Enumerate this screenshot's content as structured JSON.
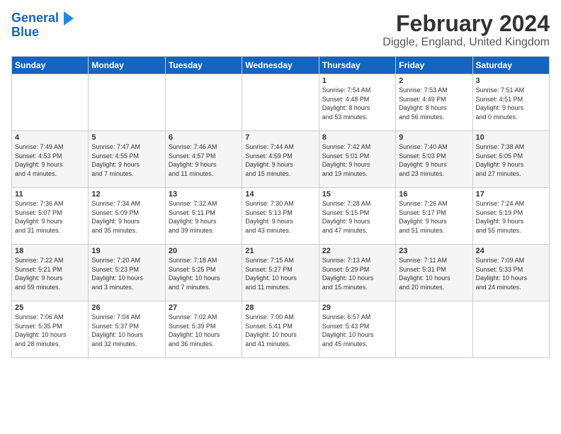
{
  "logo": {
    "line1": "General",
    "line2": "Blue"
  },
  "title": "February 2024",
  "subtitle": "Diggle, England, United Kingdom",
  "days_header": [
    "Sunday",
    "Monday",
    "Tuesday",
    "Wednesday",
    "Thursday",
    "Friday",
    "Saturday"
  ],
  "weeks": [
    [
      {
        "day": "",
        "content": ""
      },
      {
        "day": "",
        "content": ""
      },
      {
        "day": "",
        "content": ""
      },
      {
        "day": "",
        "content": ""
      },
      {
        "day": "1",
        "content": "Sunrise: 7:54 AM\nSunset: 4:48 PM\nDaylight: 8 hours\nand 53 minutes."
      },
      {
        "day": "2",
        "content": "Sunrise: 7:53 AM\nSunset: 4:49 PM\nDaylight: 8 hours\nand 56 minutes."
      },
      {
        "day": "3",
        "content": "Sunrise: 7:51 AM\nSunset: 4:51 PM\nDaylight: 9 hours\nand 0 minutes."
      }
    ],
    [
      {
        "day": "4",
        "content": "Sunrise: 7:49 AM\nSunset: 4:53 PM\nDaylight: 9 hours\nand 4 minutes."
      },
      {
        "day": "5",
        "content": "Sunrise: 7:47 AM\nSunset: 4:55 PM\nDaylight: 9 hours\nand 7 minutes."
      },
      {
        "day": "6",
        "content": "Sunrise: 7:46 AM\nSunset: 4:57 PM\nDaylight: 9 hours\nand 11 minutes."
      },
      {
        "day": "7",
        "content": "Sunrise: 7:44 AM\nSunset: 4:59 PM\nDaylight: 9 hours\nand 15 minutes."
      },
      {
        "day": "8",
        "content": "Sunrise: 7:42 AM\nSunset: 5:01 PM\nDaylight: 9 hours\nand 19 minutes."
      },
      {
        "day": "9",
        "content": "Sunrise: 7:40 AM\nSunset: 5:03 PM\nDaylight: 9 hours\nand 23 minutes."
      },
      {
        "day": "10",
        "content": "Sunrise: 7:38 AM\nSunset: 5:05 PM\nDaylight: 9 hours\nand 27 minutes."
      }
    ],
    [
      {
        "day": "11",
        "content": "Sunrise: 7:36 AM\nSunset: 5:07 PM\nDaylight: 9 hours\nand 31 minutes."
      },
      {
        "day": "12",
        "content": "Sunrise: 7:34 AM\nSunset: 5:09 PM\nDaylight: 9 hours\nand 35 minutes."
      },
      {
        "day": "13",
        "content": "Sunrise: 7:32 AM\nSunset: 5:11 PM\nDaylight: 9 hours\nand 39 minutes."
      },
      {
        "day": "14",
        "content": "Sunrise: 7:30 AM\nSunset: 5:13 PM\nDaylight: 9 hours\nand 43 minutes."
      },
      {
        "day": "15",
        "content": "Sunrise: 7:28 AM\nSunset: 5:15 PM\nDaylight: 9 hours\nand 47 minutes."
      },
      {
        "day": "16",
        "content": "Sunrise: 7:26 AM\nSunset: 5:17 PM\nDaylight: 9 hours\nand 51 minutes."
      },
      {
        "day": "17",
        "content": "Sunrise: 7:24 AM\nSunset: 5:19 PM\nDaylight: 9 hours\nand 55 minutes."
      }
    ],
    [
      {
        "day": "18",
        "content": "Sunrise: 7:22 AM\nSunset: 5:21 PM\nDaylight: 9 hours\nand 59 minutes."
      },
      {
        "day": "19",
        "content": "Sunrise: 7:20 AM\nSunset: 5:23 PM\nDaylight: 10 hours\nand 3 minutes."
      },
      {
        "day": "20",
        "content": "Sunrise: 7:18 AM\nSunset: 5:25 PM\nDaylight: 10 hours\nand 7 minutes."
      },
      {
        "day": "21",
        "content": "Sunrise: 7:15 AM\nSunset: 5:27 PM\nDaylight: 10 hours\nand 11 minutes."
      },
      {
        "day": "22",
        "content": "Sunrise: 7:13 AM\nSunset: 5:29 PM\nDaylight: 10 hours\nand 15 minutes."
      },
      {
        "day": "23",
        "content": "Sunrise: 7:11 AM\nSunset: 5:31 PM\nDaylight: 10 hours\nand 20 minutes."
      },
      {
        "day": "24",
        "content": "Sunrise: 7:09 AM\nSunset: 5:33 PM\nDaylight: 10 hours\nand 24 minutes."
      }
    ],
    [
      {
        "day": "25",
        "content": "Sunrise: 7:06 AM\nSunset: 5:35 PM\nDaylight: 10 hours\nand 28 minutes."
      },
      {
        "day": "26",
        "content": "Sunrise: 7:04 AM\nSunset: 5:37 PM\nDaylight: 10 hours\nand 32 minutes."
      },
      {
        "day": "27",
        "content": "Sunrise: 7:02 AM\nSunset: 5:39 PM\nDaylight: 10 hours\nand 36 minutes."
      },
      {
        "day": "28",
        "content": "Sunrise: 7:00 AM\nSunset: 5:41 PM\nDaylight: 10 hours\nand 41 minutes."
      },
      {
        "day": "29",
        "content": "Sunrise: 6:57 AM\nSunset: 5:43 PM\nDaylight: 10 hours\nand 45 minutes."
      },
      {
        "day": "",
        "content": ""
      },
      {
        "day": "",
        "content": ""
      }
    ]
  ]
}
